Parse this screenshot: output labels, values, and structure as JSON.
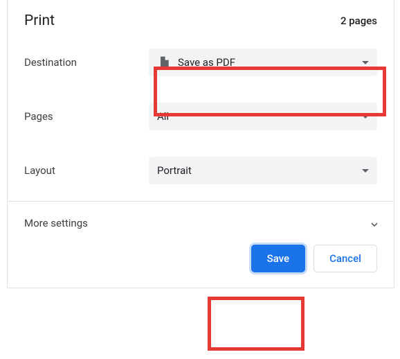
{
  "header": {
    "title": "Print",
    "page_count": "2 pages"
  },
  "rows": {
    "destination": {
      "label": "Destination",
      "value": "Save as PDF"
    },
    "pages": {
      "label": "Pages",
      "value": "All"
    },
    "layout": {
      "label": "Layout",
      "value": "Portrait"
    }
  },
  "more_settings": "More settings",
  "footer": {
    "save": "Save",
    "cancel": "Cancel"
  }
}
